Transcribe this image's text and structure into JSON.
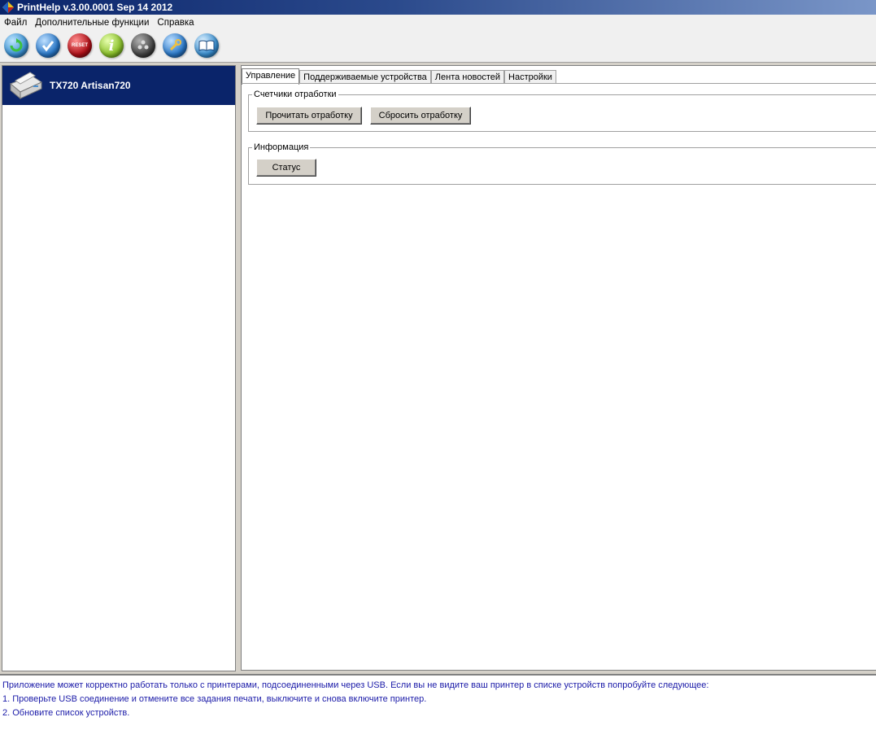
{
  "window": {
    "title": "PrintHelp v.3.00.0001 Sep 14 2012"
  },
  "menu": {
    "items": [
      "Файл",
      "Дополнительные функции",
      "Справка"
    ]
  },
  "toolbar": {
    "buttons": [
      {
        "icon": "refresh-icon",
        "color": "#3a8fd0"
      },
      {
        "icon": "check-icon",
        "color": "#2a78c8"
      },
      {
        "icon": "reset-icon",
        "color": "#b01018",
        "label": "RESET"
      },
      {
        "icon": "info-icon",
        "color": "#8ac02a"
      },
      {
        "icon": "ink-icon",
        "color": "#444444"
      },
      {
        "icon": "wrench-icon",
        "color": "#2a78c8"
      },
      {
        "icon": "book-icon",
        "color": "#3a8fd0"
      }
    ]
  },
  "devices": [
    {
      "name": "TX720 Artisan720",
      "selected": true
    }
  ],
  "tabs": [
    "Управление",
    "Поддерживаемые устройства",
    "Лента новостей",
    "Настройки"
  ],
  "active_tab": 0,
  "counters_group": {
    "title": "Счетчики отработки",
    "read_button": "Прочитать отработку",
    "reset_button": "Сбросить отработку"
  },
  "info_group": {
    "title": "Информация",
    "status_button": "Статус"
  },
  "status_messages": [
    "Приложение может корректно работать только с принтерами, подсоединенными через USB. Если вы не видите ваш принтер в списке устройств попробуйте следующее:",
    "1. Проверьте USB соединение и отмените все задания печати, выключите и снова включите принтер.",
    "2. Обновите список устройств."
  ],
  "colors": {
    "selection": "#0a246a",
    "status_text": "#1a1aa8"
  }
}
